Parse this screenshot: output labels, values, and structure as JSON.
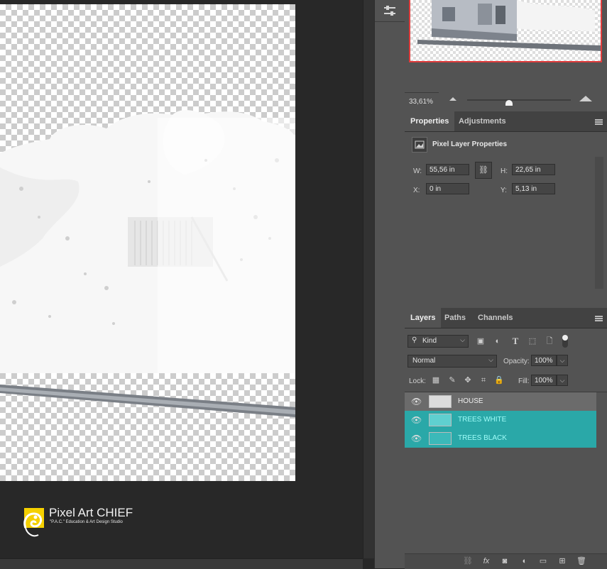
{
  "navigator": {
    "zoom": "33,61%"
  },
  "properties": {
    "tabs": [
      "Properties",
      "Adjustments"
    ],
    "header": "Pixel Layer Properties",
    "w_label": "W:",
    "w_value": "55,56 in",
    "h_label": "H:",
    "h_value": "22,65 in",
    "x_label": "X:",
    "x_value": "0 in",
    "y_label": "Y:",
    "y_value": "5,13 in"
  },
  "layers_panel": {
    "tabs": [
      "Layers",
      "Paths",
      "Channels"
    ],
    "filter_kind": "Kind",
    "blend_mode": "Normal",
    "opacity_label": "Opacity:",
    "opacity_value": "100%",
    "lock_label": "Lock:",
    "fill_label": "Fill:",
    "fill_value": "100%",
    "layers": [
      {
        "name": "HOUSE",
        "selected": false
      },
      {
        "name": "TREES WHITE",
        "selected": true
      },
      {
        "name": "TREES BLACK",
        "selected": true
      }
    ]
  },
  "watermark": {
    "brand": "Pixel Art CHIEF",
    "tagline": "\"P.A.C.\" Education & Art Design Studio"
  },
  "colors": {
    "selection": "#2aa8a8",
    "panel_bg": "#535353",
    "canvas_bg": "#282828",
    "nav_frame": "#e03c3c"
  }
}
